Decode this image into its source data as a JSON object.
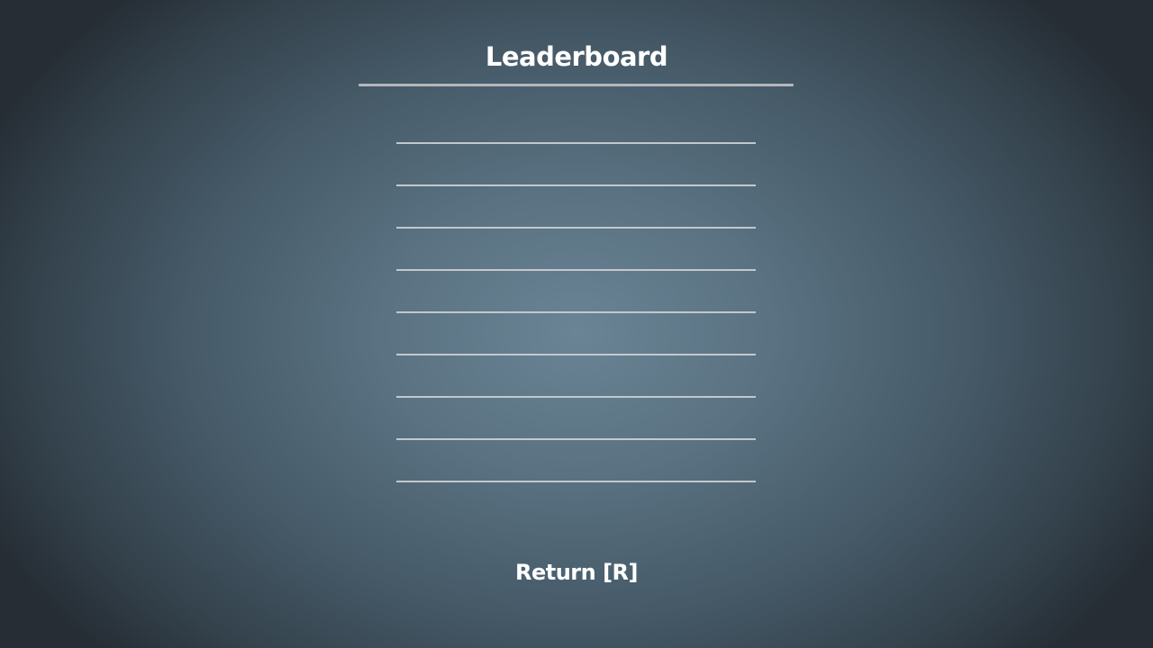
{
  "screen": {
    "title": "Leaderboard",
    "return_label": "Return [R]"
  },
  "leaderboard": {
    "rows": [
      {
        "name": "",
        "score": ""
      },
      {
        "name": "",
        "score": ""
      },
      {
        "name": "",
        "score": ""
      },
      {
        "name": "",
        "score": ""
      },
      {
        "name": "",
        "score": ""
      },
      {
        "name": "",
        "score": ""
      },
      {
        "name": "",
        "score": ""
      },
      {
        "name": "",
        "score": ""
      },
      {
        "name": "",
        "score": ""
      }
    ]
  },
  "colors": {
    "background_center": "#6a8495",
    "background_edge": "#262d35",
    "text": "#ffffff",
    "divider": "#c3c8cc",
    "title_underline": "#b3b8bc"
  }
}
